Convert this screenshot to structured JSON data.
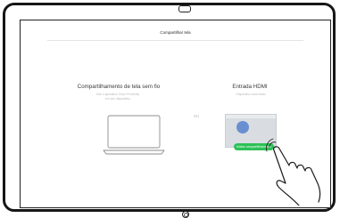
{
  "header": {
    "title": "Compartilhar tela"
  },
  "wireless": {
    "title": "Compartilhamento de tela sem fio",
    "subtitle_line1": "Use o aplicativo Cisco Proximity",
    "subtitle_line2": "em seu dispositivo",
    "icon": "laptop-icon"
  },
  "divider": {
    "or_label": "OU"
  },
  "hdmi": {
    "title": "Entrada HDMI",
    "subtitle": "Dispositivo conectado",
    "start_button_label": "Iniciar compartilhamento",
    "accent_color": "#2cc156"
  },
  "gesture": {
    "icon": "tap-hand-icon"
  },
  "device": {
    "frame_color": "#161616"
  }
}
